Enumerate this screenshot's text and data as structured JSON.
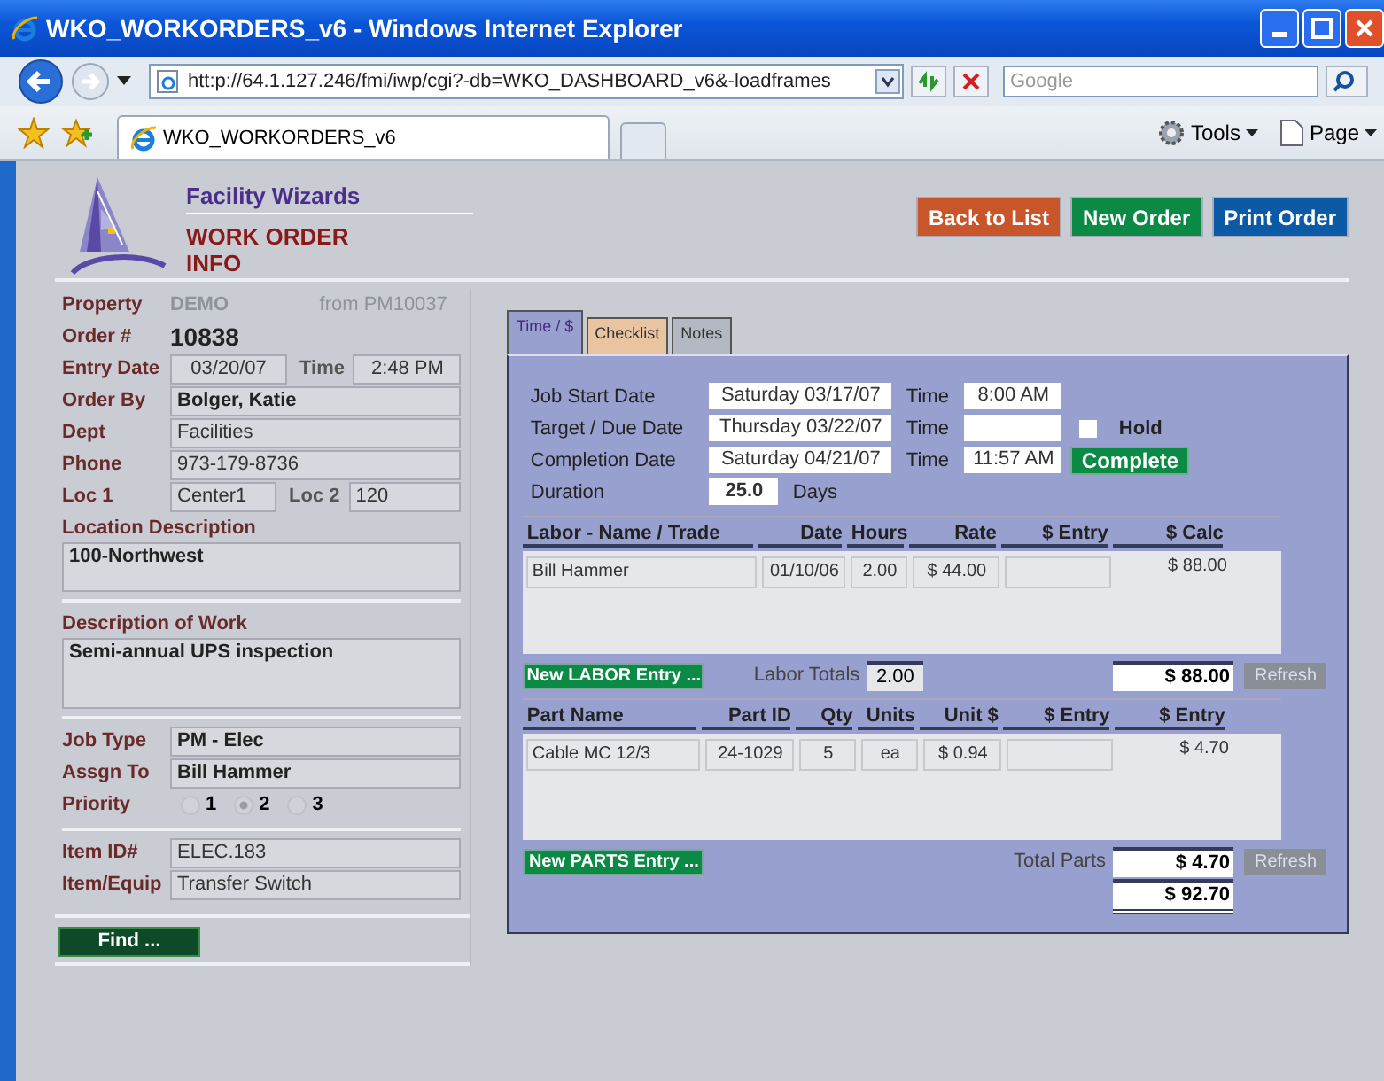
{
  "window": {
    "title": "WKO_WORKORDERS_v6 - Windows Internet Explorer"
  },
  "browser": {
    "address": "htt:p://64.1.127.246/fmi/iwp/cgi?-db=WKO_DASHBOARD_v6&-loadframes",
    "search_placeholder": "Google",
    "tabs": [
      {
        "label": "WKO_WORKORDERS_v6"
      }
    ],
    "tools": [
      "Tools",
      "Page"
    ]
  },
  "header": {
    "brand": "Facility Wizards",
    "title_lines": [
      "WORK ORDER",
      "INFO"
    ]
  },
  "actions": [
    {
      "label": "Back to List",
      "color": "#c9552b"
    },
    {
      "label": "New Order",
      "color": "#0b8a45"
    },
    {
      "label": "Print Order",
      "color": "#0b5aa6"
    }
  ],
  "left": {
    "groups": [
      [
        {
          "kind": "property",
          "label": "Property",
          "value": "DEMO",
          "note": "from PM10037"
        },
        {
          "kind": "order",
          "label": "Order #",
          "value": "10838"
        },
        {
          "kind": "datetime",
          "label": "Entry Date",
          "value": "03/20/07",
          "time_label": "Time",
          "time": "2:48 PM"
        },
        {
          "kind": "field",
          "label": "Order By",
          "value": "Bolger, Katie",
          "bold": true
        },
        {
          "kind": "field",
          "label": "Dept",
          "value": "Facilities",
          "bold": false
        },
        {
          "kind": "field",
          "label": "Phone",
          "value": "973-179-8736",
          "bold": false
        },
        {
          "kind": "pair",
          "label": "Loc 1",
          "value": "Center1",
          "label2": "Loc 2",
          "value2": "120"
        },
        {
          "kind": "area",
          "label": "Location Description",
          "value": "100-Northwest",
          "tall": false
        }
      ],
      [
        {
          "kind": "area",
          "label": "Description of Work",
          "value": "Semi-annual UPS inspection",
          "tall": true
        }
      ],
      [
        {
          "kind": "field",
          "label": "Job Type",
          "value": "PM - Elec",
          "bold": true
        },
        {
          "kind": "field",
          "label": "Assgn To",
          "value": "Bill Hammer",
          "bold": true
        },
        {
          "kind": "radio",
          "label": "Priority",
          "options": [
            {
              "label": "1",
              "selected": false
            },
            {
              "label": "2",
              "selected": true
            },
            {
              "label": "3",
              "selected": false
            }
          ]
        }
      ],
      [
        {
          "kind": "field",
          "label": "Item ID#",
          "value": "ELEC.183",
          "bold": false
        },
        {
          "kind": "field",
          "label": "Item/Equip",
          "value": "Transfer Switch",
          "bold": false
        }
      ]
    ],
    "find_button": "Find ..."
  },
  "panel": {
    "tabs": [
      {
        "label": "Time / $",
        "selected": true,
        "color": "#97a0cf"
      },
      {
        "label": "Checklist",
        "selected": false,
        "color": "#e8c4a0"
      },
      {
        "label": "Notes",
        "selected": false,
        "color": "#b4b8c2"
      }
    ],
    "schedule": [
      {
        "label": "Job Start Date",
        "date": "Saturday 03/17/07",
        "time_label": "Time",
        "time": "8:00 AM"
      },
      {
        "label": "Target / Due Date",
        "date": "Thursday 03/22/07",
        "time_label": "Time",
        "hold": {
          "label": "Hold",
          "checked": false
        }
      },
      {
        "label": "Completion Date",
        "date": "Saturday 04/21/07",
        "time_label": "Time",
        "time": "11:57 AM",
        "complete_button": "Complete"
      }
    ],
    "duration": {
      "label": "Duration",
      "value": "25.0",
      "unit": "Days"
    },
    "labor": {
      "columns": [
        "Labor - Name / Trade",
        "Date",
        "Hours",
        "Rate",
        "$ Entry",
        "$ Calc"
      ],
      "rows": [
        {
          "cells": [
            "Bill Hammer",
            "01/10/06",
            "2.00",
            "$ 44.00"
          ],
          "calc": "$ 88.00"
        }
      ],
      "new_button": "New LABOR Entry ...",
      "totals_label": "Labor Totals",
      "totals_hours": "2.00",
      "total": "$ 88.00",
      "refresh": "Refresh"
    },
    "parts": {
      "columns": [
        "Part Name",
        "Part ID",
        "Qty",
        "Units",
        "Unit $",
        "$ Entry",
        "$ Entry"
      ],
      "rows": [
        {
          "cells": [
            "Cable MC 12/3",
            "24-1029",
            "5",
            "ea",
            "$ 0.94"
          ],
          "calc": "$ 4.70"
        }
      ],
      "new_button": "New PARTS Entry ...",
      "total_label": "Total Parts",
      "total": "$ 4.70",
      "refresh": "Refresh",
      "grand_total": "$ 92.70"
    }
  }
}
